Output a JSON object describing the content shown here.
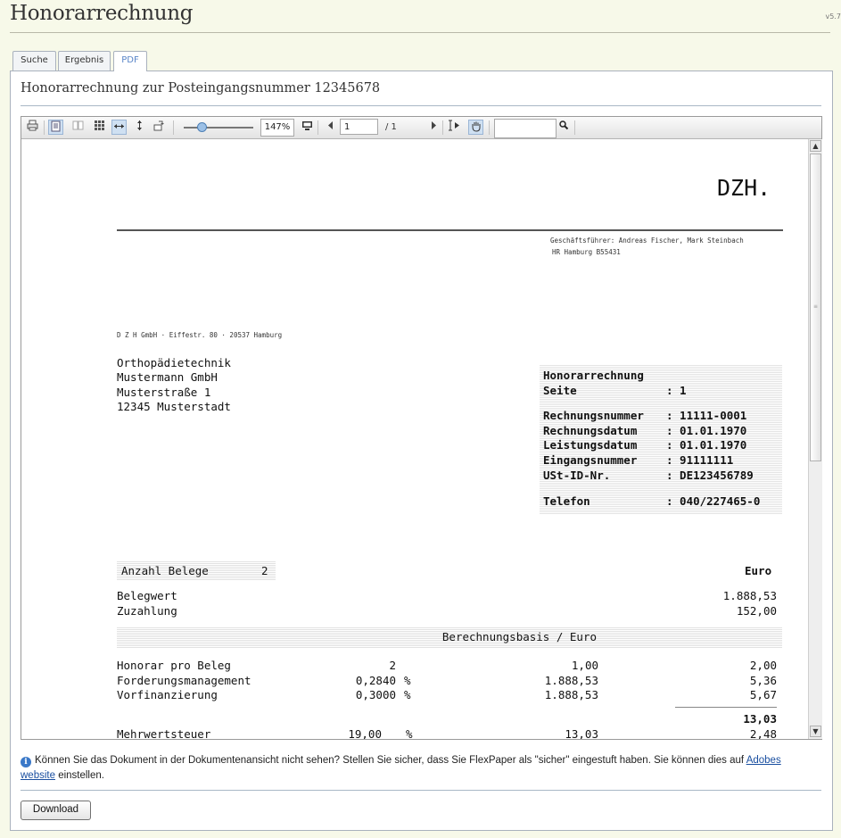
{
  "app": {
    "title": "Honorarrechnung",
    "version": "v5.7"
  },
  "tabs": [
    {
      "label": "Suche"
    },
    {
      "label": "Ergebnis"
    },
    {
      "label": "PDF"
    }
  ],
  "panel": {
    "heading": "Honorarrechnung zur Posteingangsnummer 12345678"
  },
  "viewer": {
    "toolbar": {
      "zoom": "147%",
      "page_current": "1",
      "page_total": "/ 1",
      "search_value": ""
    }
  },
  "document": {
    "logo": "DZH.",
    "header_info": [
      "Geschäftsführer: Andreas Fischer, Mark Steinbach",
      "HR Hamburg B55431"
    ],
    "sender_line": "D Z H  GmbH · Eiffestr. 80 · 20537 Hamburg",
    "address": [
      "Orthopädietechnik",
      "Mustermann GmbH",
      "Musterstraße 1",
      "12345 Musterstadt"
    ],
    "infobox": {
      "title": "Honorarrechnung",
      "rows": [
        {
          "label": "Seite",
          "value": ": 1"
        },
        {
          "label": "Rechnungsnummer",
          "value": ": 11111-0001"
        },
        {
          "label": "Rechnungsdatum",
          "value": ": 01.01.1970"
        },
        {
          "label": "Leistungsdatum",
          "value": ": 01.01.1970"
        },
        {
          "label": "Eingangsnummer",
          "value": ": 91111111"
        },
        {
          "label": "USt-ID-Nr.",
          "value": ": DE123456789"
        },
        {
          "label": "Telefon",
          "value": ": 040/227465-0"
        }
      ]
    },
    "anzahl_label": "Anzahl Belege",
    "anzahl_value": "2",
    "currency_header": "Euro",
    "belegwert_label": "Belegwert",
    "belegwert_value": "1.888,53",
    "zuzahlung_label": "Zuzahlung",
    "zuzahlung_value": "152,00",
    "basis_header": "Berechnungsbasis / Euro",
    "lines": [
      {
        "label": "Honorar pro Beleg",
        "qty": "2",
        "unit": "",
        "basis": "1,00",
        "amount": "2,00"
      },
      {
        "label": "Forderungsmanagement",
        "qty": "0,2840",
        "unit": "%",
        "basis": "1.888,53",
        "amount": "5,36"
      },
      {
        "label": "Vorfinanzierung",
        "qty": "0,3000",
        "unit": "%",
        "basis": "1.888,53",
        "amount": "5,67"
      }
    ],
    "subtotal": "13,03",
    "mwst": {
      "label": "Mehrwertsteuer",
      "qty": "19,00",
      "unit": "%",
      "basis": "13,03",
      "amount": "2,48"
    }
  },
  "notice": {
    "text_before": "Können Sie das Dokument in der Dokumentenansicht nicht sehen? Stellen Sie sicher, dass Sie FlexPaper als \"sicher\" eingestuft haben. Sie können dies auf ",
    "link": "Adobes website",
    "text_after": " einstellen."
  },
  "download_label": "Download"
}
